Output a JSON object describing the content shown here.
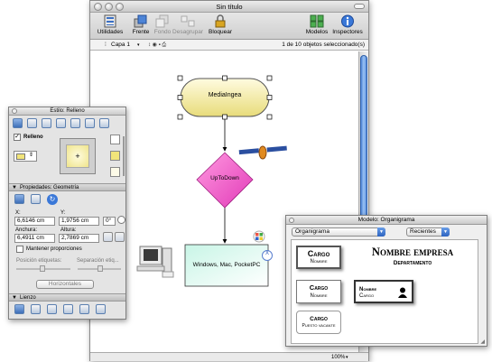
{
  "main_window": {
    "title": "Sin título",
    "toolbar": [
      {
        "label": "Utilidades",
        "icon": "utilities-icon",
        "enabled": true
      },
      {
        "label": "Frente",
        "icon": "bring-to-front-icon",
        "enabled": true
      },
      {
        "label": "Fondo",
        "icon": "send-to-back-icon",
        "enabled": false
      },
      {
        "label": "Desagrupar",
        "icon": "ungroup-icon",
        "enabled": false
      },
      {
        "label": "Bloquear",
        "icon": "lock-icon",
        "enabled": true
      },
      {
        "label": "Modelos",
        "icon": "templates-icon",
        "enabled": true
      },
      {
        "label": "Inspectores",
        "icon": "info-icon",
        "enabled": true
      }
    ],
    "layer": "Capa 1",
    "selection_status": "1 de 10 objetos seleccionado(s)",
    "zoom": "100%",
    "canvas": {
      "shape1": "MediaIngea",
      "shape2": "UpToDown",
      "shape3": "Windows, Mac, PocketPC",
      "mac_badge": "X"
    }
  },
  "inspector": {
    "title": "Estilo: Relleno",
    "fill_label": "Relleno",
    "fill_checked": true,
    "geometry_header": "Propiedades: Geometría",
    "x_label": "X:",
    "x_value": "6,6146 cm",
    "y_label": "Y:",
    "y_value": "1,9756 cm",
    "rotation_value": "0°",
    "width_label": "Anchura:",
    "width_value": "6,4911 cm",
    "height_label": "Altura:",
    "height_value": "2,7869 cm",
    "keep_proportions": "Mantener proporciones",
    "label_position": "Posición etiquetas:",
    "label_separation": "Separación etiq...",
    "orientation": "Horizontales",
    "canvas_header": "Lienzo"
  },
  "palette": {
    "title": "Modelo: Organigrama",
    "selected_template": "Organigrama",
    "recents": "Recientes",
    "card1_title": "Cargo",
    "card1_sub": "Nombre",
    "company_name": "Nombre empresa",
    "department": "Departamento",
    "card2_title": "Cargo",
    "card2_sub": "Nombre",
    "card3_line1": "Nombre",
    "card3_line2": "Cargo",
    "card4_title": "Cargo",
    "card4_sub": "Puesto vacante"
  },
  "colors": {
    "pill_fill": "#f6f0b0",
    "diamond_fill": "#ff66cc",
    "rect_fill": "#b8f0de",
    "selection_blue": "#3e6fb8"
  }
}
